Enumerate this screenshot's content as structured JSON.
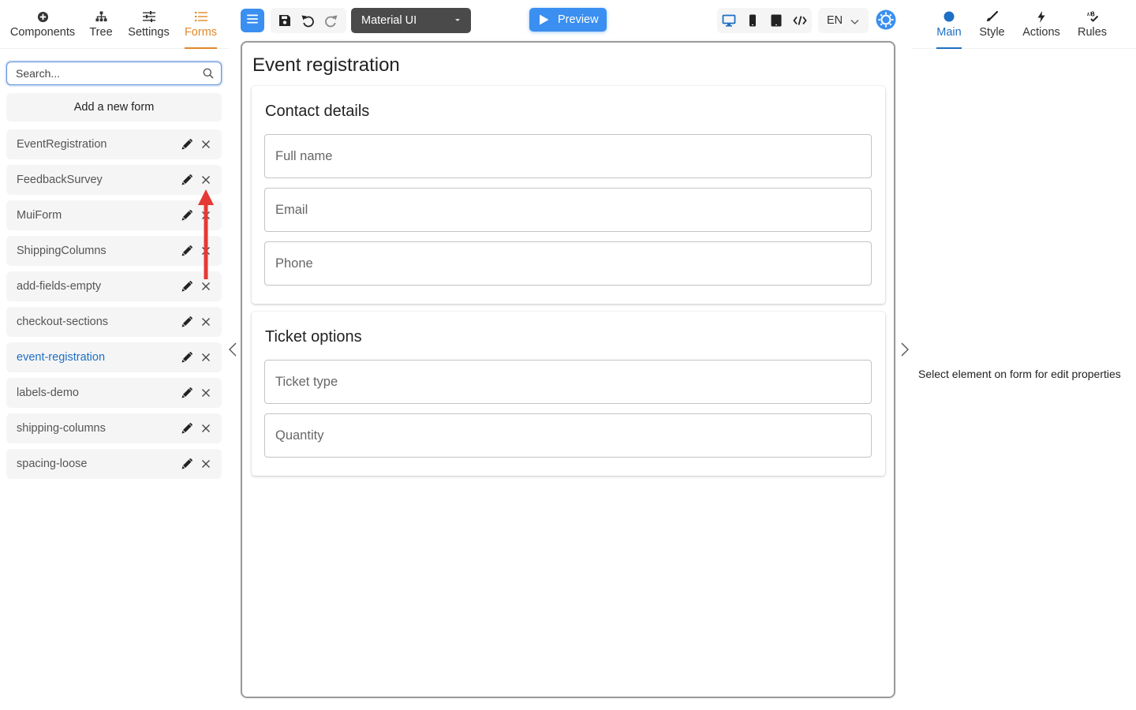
{
  "left_tabs": [
    {
      "label": "Components",
      "icon": "plus-circle-icon"
    },
    {
      "label": "Tree",
      "icon": "tree-icon"
    },
    {
      "label": "Settings",
      "icon": "sliders-icon"
    },
    {
      "label": "Forms",
      "icon": "list-icon",
      "active": true
    }
  ],
  "search": {
    "placeholder": "Search...",
    "value": ""
  },
  "add_form_label": "Add a new form",
  "forms": [
    {
      "name": "EventRegistration"
    },
    {
      "name": "FeedbackSurvey"
    },
    {
      "name": "MuiForm"
    },
    {
      "name": "ShippingColumns"
    },
    {
      "name": "add-fields-empty"
    },
    {
      "name": "checkout-sections"
    },
    {
      "name": "event-registration",
      "active": true
    },
    {
      "name": "labels-demo"
    },
    {
      "name": "shipping-columns"
    },
    {
      "name": "spacing-loose"
    }
  ],
  "toolbar": {
    "theme": "Material UI",
    "preview_label": "Preview",
    "language": "EN"
  },
  "form": {
    "title": "Event registration",
    "sections": [
      {
        "title": "Contact details",
        "fields": [
          "Full name",
          "Email",
          "Phone"
        ]
      },
      {
        "title": "Ticket options",
        "fields": [
          "Ticket type",
          "Quantity"
        ]
      }
    ]
  },
  "right_tabs": [
    {
      "label": "Main",
      "icon": "dot-icon",
      "active": true
    },
    {
      "label": "Style",
      "icon": "brush-icon"
    },
    {
      "label": "Actions",
      "icon": "lightning-icon"
    },
    {
      "label": "Rules",
      "icon": "rules-icon"
    }
  ],
  "properties_hint": "Select element on form for edit properties",
  "colors": {
    "accent_orange": "#e0892a",
    "accent_blue": "#1e6fc6",
    "primary_button": "#3b8ff0",
    "annotation_arrow": "#e53935"
  }
}
